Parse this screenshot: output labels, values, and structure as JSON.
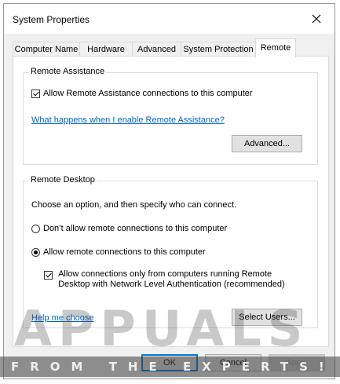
{
  "window": {
    "title": "System Properties"
  },
  "tabs": [
    {
      "label": "Computer Name",
      "active": false
    },
    {
      "label": "Hardware",
      "active": false
    },
    {
      "label": "Advanced",
      "active": false
    },
    {
      "label": "System Protection",
      "active": false
    },
    {
      "label": "Remote",
      "active": true
    }
  ],
  "remote_assistance": {
    "group_label": "Remote Assistance",
    "allow_label": "Allow Remote Assistance connections to this computer",
    "allow_checked": true,
    "help_link": "What happens when I enable Remote Assistance?",
    "advanced_button": "Advanced..."
  },
  "remote_desktop": {
    "group_label": "Remote Desktop",
    "instruction": "Choose an option, and then specify who can connect.",
    "option_dont_allow": "Don’t allow remote connections to this computer",
    "option_allow": "Allow remote connections to this computer",
    "selected_option": "allow",
    "nla_label_line1": "Allow connections only from computers running Remote",
    "nla_label_line2": "Desktop with Network Level Authentication (recommended)",
    "nla_checked": true,
    "help_link": "Help me choose",
    "select_users_button": "Select Users..."
  },
  "footer": {
    "ok": "OK",
    "cancel": "Cancel",
    "apply": "Apply"
  },
  "watermark": {
    "logo_text": "APPUALS",
    "tagline": "FROM THE EXPERTS!"
  },
  "colors": {
    "link": "#0066cc",
    "accent": "#0078d7"
  }
}
